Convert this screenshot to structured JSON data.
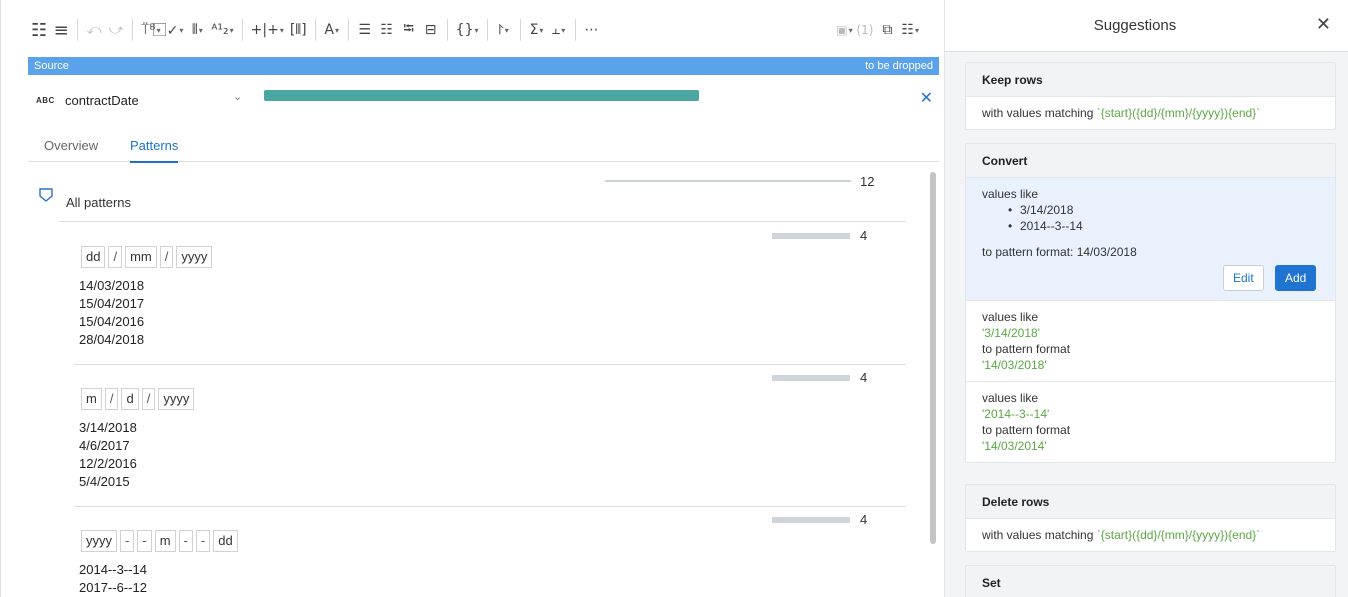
{
  "toolbar": {
    "icons": [
      "grid-menu-icon",
      "list-icon",
      "undo-icon",
      "redo-icon",
      "rename-icon",
      "validate-icon",
      "merge-icon",
      "split-icon",
      "add-column-icon",
      "format-icon",
      "text-icon",
      "nest-icon",
      "unnest-icon",
      "restructure-icon",
      "join-icon",
      "object-icon",
      "filter-icon",
      "aggregate-icon",
      "pivot-icon",
      "more-icon"
    ],
    "glyphs": {
      "grid": "☷",
      "list": "≡",
      "undo": "⤺",
      "redo": "⤻",
      "rename": "⍡ᴮ",
      "validate": "⃞✓",
      "merge": "⫴",
      "split": "ᴬ¹₂",
      "add_col": "+|+",
      "format": "[⫴]",
      "text": "A",
      "nest": "☰",
      "unnest": "☷",
      "restructure": "⭾",
      "join": "⊟",
      "object": "{}",
      "filter": "⨡",
      "aggregate": "Σ",
      "pivot": "⫠",
      "more": "⋯"
    },
    "dropdown_glyph": "▾",
    "selection_count": "(1)"
  },
  "source": {
    "label": "Source",
    "status": "to be dropped"
  },
  "column": {
    "type_badge": "ABC",
    "name": "contractDate",
    "quality_color": "#4ba5a0"
  },
  "tabs": [
    {
      "label": "Overview",
      "active": false
    },
    {
      "label": "Patterns",
      "active": true
    }
  ],
  "patterns": {
    "all_label": "All patterns",
    "all_count": "12",
    "groups": [
      {
        "tokens": [
          "dd",
          "/",
          "mm",
          "/",
          "yyyy"
        ],
        "count": "4",
        "values": [
          "14/03/2018",
          "15/04/2017",
          "15/04/2016",
          "28/04/2018"
        ]
      },
      {
        "tokens": [
          "m",
          "/",
          "d",
          "/",
          "yyyy"
        ],
        "count": "4",
        "values": [
          "3/14/2018",
          "4/6/2017",
          "12/2/2016",
          "5/4/2015"
        ]
      },
      {
        "tokens": [
          "yyyy",
          "-",
          "-",
          "m",
          "-",
          "-",
          "dd"
        ],
        "count": "4",
        "values": [
          "2014--3--14",
          "2017--6--12"
        ]
      }
    ]
  },
  "suggestions": {
    "title": "Suggestions",
    "close_glyph": "✕",
    "keep_rows": {
      "title": "Keep rows",
      "prefix": "with values matching ",
      "pattern": "`{start}({dd}/{mm}/{yyyy}){end}`"
    },
    "convert": {
      "title": "Convert",
      "selected": {
        "values_like": "values like",
        "examples": [
          "3/14/2018",
          "2014--3--14"
        ],
        "target": "to pattern format: 14/03/2018",
        "edit_label": "Edit",
        "add_label": "Add"
      },
      "items": [
        {
          "values_like": "values like",
          "example": "'3/14/2018'",
          "to_label": "to pattern format",
          "target": "'14/03/2018'"
        },
        {
          "values_like": "values like",
          "example": "'2014--3--14'",
          "to_label": "to pattern format",
          "target": "'14/03/2014'"
        }
      ]
    },
    "delete_rows": {
      "title": "Delete rows",
      "prefix": "with values matching ",
      "pattern": "`{start}({dd}/{mm}/{yyyy}){end}`"
    },
    "set": {
      "title": "Set"
    }
  }
}
